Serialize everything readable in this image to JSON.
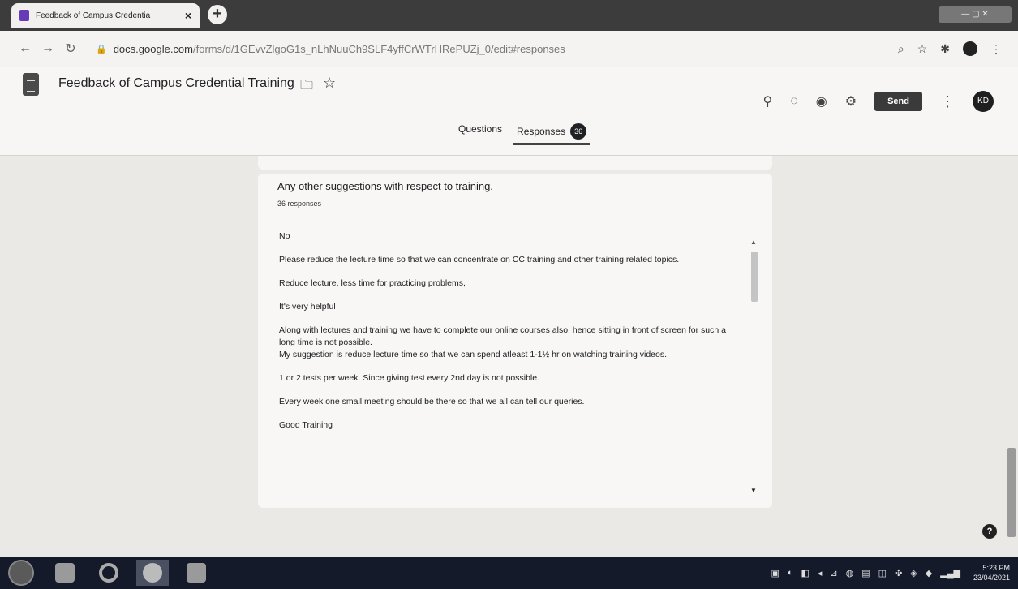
{
  "browser": {
    "tab_title": "Feedback of Campus Credentia",
    "tab_close": "×",
    "new_tab": "+",
    "url_host": "docs.google.com",
    "url_path": "/forms/d/1GEvvZlgoG1s_nLhNuuCh9SLF4yffCrWTrHRePUZj_0/edit#responses"
  },
  "form": {
    "title": "Feedback of Campus Credential Training",
    "send_label": "Send",
    "avatar_initials": "KD",
    "tabs": {
      "questions": "Questions",
      "responses": "Responses",
      "responses_count": "36"
    }
  },
  "question": {
    "title": "Any other suggestions with respect to training.",
    "count": "36 responses",
    "responses": [
      "No",
      "Please reduce the lecture time so that we can concentrate on CC training and other training related topics.",
      "Reduce lecture, less time for practicing problems,",
      "It's very helpful",
      "Along with lectures and training we have to complete our online courses also, hence sitting in front of screen for such a long time is not possible.\nMy suggestion is reduce lecture time so that we can spend atleast 1-1½ hr on watching training videos.",
      "1 or 2 tests per week. Since giving test every 2nd day is not possible.",
      "Every week one small meeting should be there so that we all can tell our queries.",
      "Good Training"
    ]
  },
  "taskbar": {
    "time": "5:23 PM",
    "date": "23/04/2021"
  },
  "icons": {
    "help": "?"
  }
}
